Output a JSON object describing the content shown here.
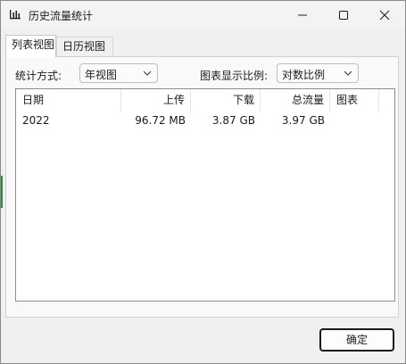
{
  "window": {
    "title": "历史流量统计",
    "icon": "bar-chart-icon"
  },
  "tabs": [
    {
      "label": "列表视图",
      "active": true
    },
    {
      "label": "日历视图",
      "active": false
    }
  ],
  "controls": {
    "stat_mode_label": "统计方式:",
    "stat_mode_value": "年视图",
    "chart_scale_label": "图表显示比例:",
    "chart_scale_value": "对数比例"
  },
  "table": {
    "columns": [
      "日期",
      "上传",
      "下载",
      "总流量",
      "图表"
    ],
    "rows": [
      [
        "2022",
        "96.72 MB",
        "3.87 GB",
        "3.97 GB",
        ""
      ]
    ]
  },
  "footer": {
    "ok_label": "确定"
  }
}
